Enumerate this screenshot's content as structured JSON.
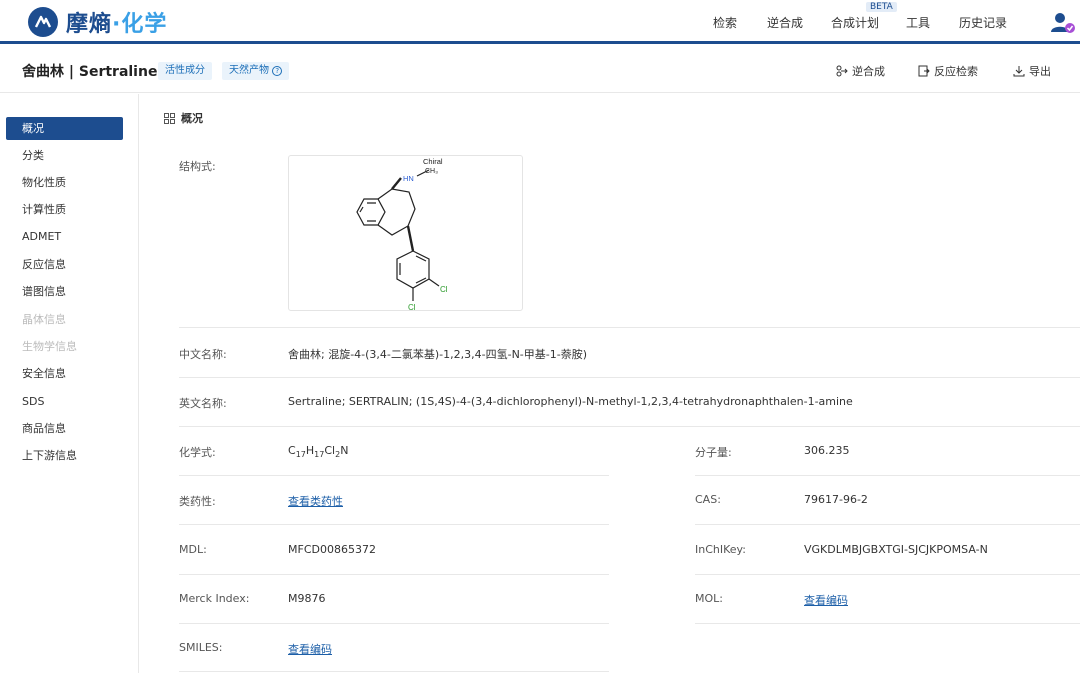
{
  "app": {
    "name_main": "摩熵",
    "name_accent": "·化学"
  },
  "nav": {
    "items": [
      "检索",
      "逆合成",
      "合成计划",
      "工具",
      "历史记录"
    ],
    "beta": "BETA"
  },
  "page": {
    "title": "舍曲林 | Sertraline",
    "tags": [
      "活性成分",
      "天然产物"
    ],
    "actions": [
      "逆合成",
      "反应检索",
      "导出"
    ]
  },
  "sidebar": {
    "items": [
      "概况",
      "分类",
      "物化性质",
      "计算性质",
      "ADMET",
      "反应信息",
      "谱图信息",
      "晶体信息",
      "生物学信息",
      "安全信息",
      "SDS",
      "商品信息",
      "上下游信息"
    ]
  },
  "section": {
    "title": "概况"
  },
  "structure": {
    "label": "结构式:",
    "chiral": "Chiral",
    "hn": "HN",
    "ch3": "CH₃",
    "cl1": "Cl",
    "cl2": "Cl"
  },
  "fields": {
    "cn_name": {
      "label": "中文名称:",
      "value": "舍曲林; 混旋-4-(3,4-二氯苯基)-1,2,3,4-四氢-N-甲基-1-萘胺)"
    },
    "en_name": {
      "label": "英文名称:",
      "value": "Sertraline; SERTRALIN; (1S,4S)-4-(3,4-dichlorophenyl)-N-methyl-1,2,3,4-tetrahydronaphthalen-1-amine"
    },
    "formula": {
      "label": "化学式:",
      "c": "C",
      "c_n": "17",
      "h": "H",
      "h_n": "17",
      "cl": "Cl",
      "cl_n": "2",
      "n": "N"
    },
    "mw": {
      "label": "分子量:",
      "value": "306.235"
    },
    "druglike": {
      "label": "类药性:",
      "value": "查看类药性"
    },
    "cas": {
      "label": "CAS:",
      "value": "79617-96-2"
    },
    "mdl": {
      "label": "MDL:",
      "value": "MFCD00865372"
    },
    "inchikey": {
      "label": "InChIKey:",
      "value": "VGKDLMBJGBXTGI-SJCJKPOMSA-N"
    },
    "merck": {
      "label": "Merck Index:",
      "value": "M9876"
    },
    "mol": {
      "label": "MOL:",
      "value": "查看编码"
    },
    "smiles": {
      "label": "SMILES:",
      "value": "查看编码"
    }
  },
  "colors": {
    "brand": "#1d4d8f",
    "link": "#1d5fa8",
    "tag_bg": "#eaf3fb"
  }
}
